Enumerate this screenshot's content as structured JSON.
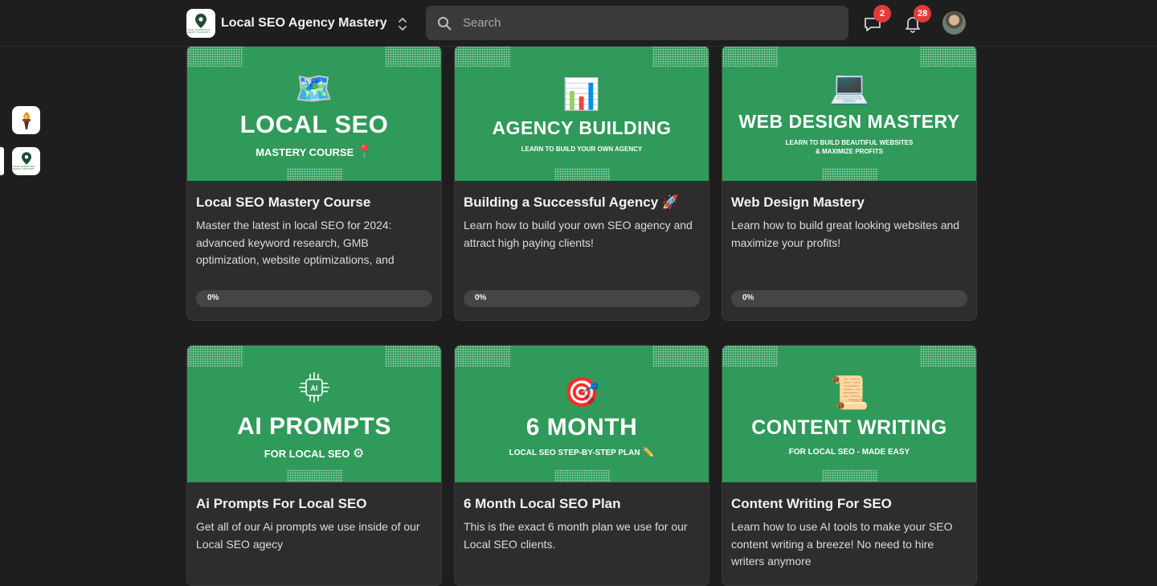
{
  "header": {
    "workspace_name": "Local SEO Agency Mastery",
    "logo_small_text": "LOCAL MARKETING AGENCY MASTERY",
    "search_placeholder": "Search",
    "messages_count": "2",
    "notifications_count": "28"
  },
  "colors": {
    "background": "#1e1e1e",
    "card_bg": "#2d2d2d",
    "thumb_green": "#2f9a5a",
    "badge_red": "#e23b3b",
    "search_bg": "#3a3a3a"
  },
  "rail": [
    {
      "icon": "torch-icon"
    },
    {
      "icon": "location-pin-icon",
      "active": true
    }
  ],
  "courses": [
    {
      "thumb_title": "LOCAL SEO",
      "thumb_subtitle": "MASTERY COURSE",
      "thumb_subtitle_emoji": "📍",
      "thumb_icon": "🗺️",
      "title": "Local SEO Mastery Course",
      "description": "Master the latest in local SEO for 2024: advanced keyword research, GMB optimization, website optimizations, and",
      "progress": "0%"
    },
    {
      "thumb_title": "AGENCY BUILDING",
      "thumb_subtitle": "LEARN TO BUILD YOUR OWN AGENCY",
      "thumb_subtitle_emoji": "",
      "thumb_icon": "📊",
      "title": "Building a Successful Agency 🚀",
      "description": "Learn how to build your own SEO agency and attract high paying clients!",
      "progress": "0%"
    },
    {
      "thumb_title": "WEB DESIGN MASTERY",
      "thumb_subtitle": "LEARN TO BUILD BEAUTIFUL WEBSITES",
      "thumb_subtitle2": "& MAXIMIZE PROFITS",
      "thumb_subtitle_emoji": "",
      "thumb_icon": "💻",
      "title": "Web Design Mastery",
      "description": "Learn how to build great looking websites and maximize your profits!",
      "progress": "0%"
    },
    {
      "thumb_title": "AI PROMPTS",
      "thumb_subtitle": "FOR LOCAL SEO",
      "thumb_subtitle_emoji": "⚙",
      "thumb_icon": "🤖",
      "title": "Ai Prompts For Local SEO",
      "description": "Get all of our Ai prompts we use inside of our Local SEO agecy",
      "progress": ""
    },
    {
      "thumb_title": "6 MONTH",
      "thumb_subtitle": "LOCAL SEO STEP-BY-STEP PLAN",
      "thumb_subtitle_emoji": "✏️",
      "thumb_icon": "🎯",
      "title": "6 Month Local SEO Plan",
      "description": "This is the exact 6 month plan we use for our Local SEO clients.",
      "progress": ""
    },
    {
      "thumb_title": "CONTENT WRITING",
      "thumb_subtitle": "FOR LOCAL SEO - MADE EASY",
      "thumb_subtitle_emoji": "",
      "thumb_icon": "📜",
      "title": "Content Writing For SEO",
      "description": "Learn how to use AI tools to make your SEO content writing a breeze! No need to hire writers anymore",
      "progress": ""
    }
  ]
}
